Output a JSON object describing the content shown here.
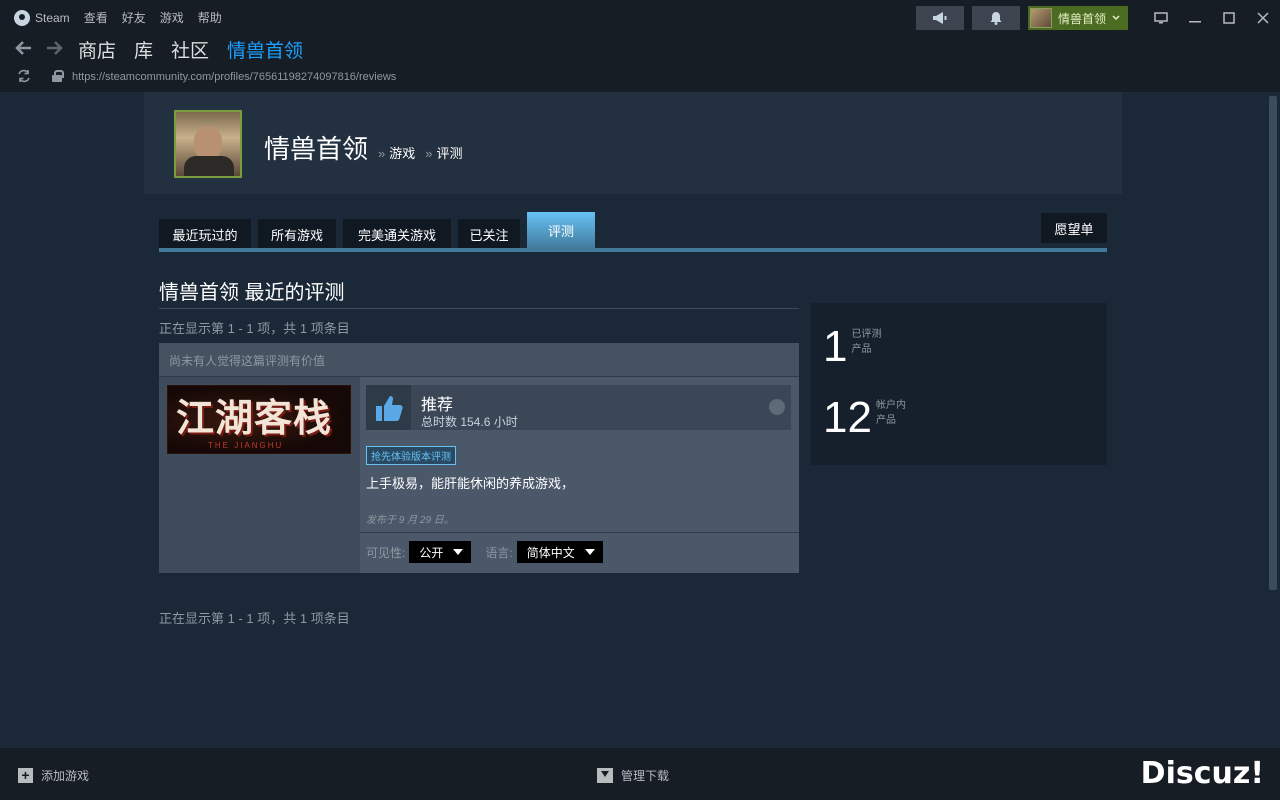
{
  "window": {
    "menu": [
      "Steam",
      "查看",
      "好友",
      "游戏",
      "帮助"
    ],
    "user_name": "情兽首领",
    "controls": [
      "minimize",
      "maximize",
      "close"
    ]
  },
  "nav": {
    "links": [
      "商店",
      "库",
      "社区",
      "情兽首领"
    ],
    "active_index": 3
  },
  "url": "https://steamcommunity.com/profiles/76561198274097816/reviews",
  "profile": {
    "name": "情兽首领",
    "breadcrumb_sep": "»",
    "crumb_games": "游戏",
    "crumb_reviews": "评测"
  },
  "tabs": {
    "items": [
      "最近玩过的",
      "所有游戏",
      "完美通关游戏",
      "已关注",
      "评测"
    ],
    "active_index": 4,
    "wishlist": "愿望单"
  },
  "reviews": {
    "title": "情兽首领 最近的评测",
    "showing_top": "正在显示第 1 - 1 项，共 1 项条目",
    "showing_bottom": "正在显示第 1 - 1 项，共 1 项条目",
    "items": [
      {
        "helpful_text": "尚未有人觉得这篇评测有价值",
        "game_logo_text": "江湖客栈",
        "game_logo_sub": "THE JIANGHU",
        "recommendation": "推荐",
        "hours": "总时数 154.6 小时",
        "badge": "抢先体验版本评测",
        "text": "上手极易，能肝能休闲的养成游戏，",
        "posted": "发布于 9 月 29 日。",
        "visibility_label": "可见性:",
        "visibility_value": "公开",
        "language_label": "语言:",
        "language_value": "简体中文"
      }
    ]
  },
  "stats": {
    "reviewed_count": "1",
    "reviewed_label_1": "已评测",
    "reviewed_label_2": "产品",
    "owned_count": "12",
    "owned_label_1": "帐户内",
    "owned_label_2": "产品"
  },
  "bottom": {
    "add_game": "添加游戏",
    "downloads": "管理下载",
    "watermark": "Discuz!"
  },
  "colors": {
    "accent": "#1a9fff",
    "tab_active": "#67c1f5",
    "user_badge": "#4c6b22",
    "page_bg": "#1b2838"
  },
  "icons": [
    "steam-logo-icon",
    "announce-icon",
    "bell-icon",
    "chevron-down-icon",
    "monitor-icon",
    "back-icon",
    "forward-icon",
    "refresh-icon",
    "lock-icon",
    "thumbs-up-icon",
    "steam-mini-icon",
    "plus-icon",
    "download-icon"
  ]
}
